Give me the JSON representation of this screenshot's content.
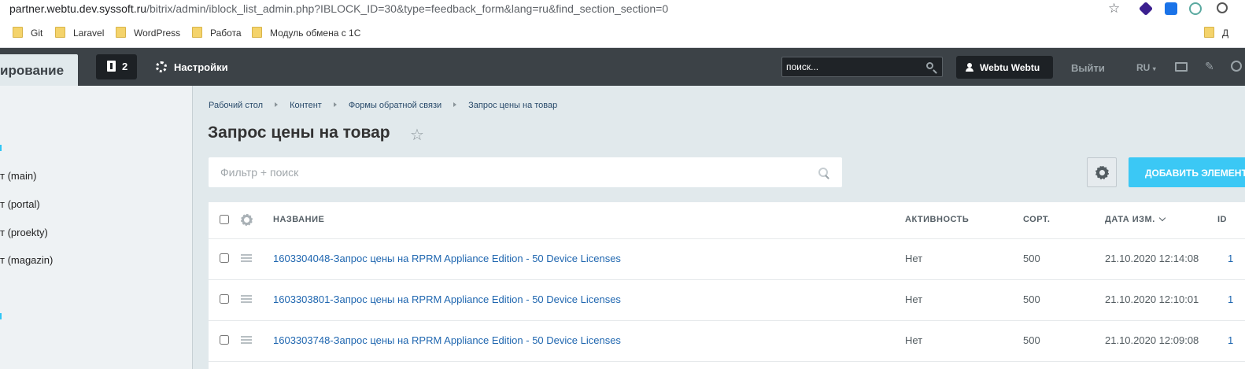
{
  "browser": {
    "url_host": "partner.webtu.dev.syssoft.ru",
    "url_path": "/bitrix/admin/iblock_list_admin.php?IBLOCK_ID=30&type=feedback_form&lang=ru&find_section_section=0",
    "bookmarks": [
      "Git",
      "Laravel",
      "WordPress",
      "Работа",
      "Модуль обмена с 1С"
    ],
    "bookmark_right": "Д"
  },
  "topbar": {
    "admin_tab": "ирование",
    "notifications_count": "2",
    "settings_label": "Настройки",
    "search_placeholder": "поиск...",
    "user_name": "Webtu Webtu",
    "logout_label": "Выйти",
    "lang_label": "RU"
  },
  "leftmenu": {
    "items": [
      "т (main)",
      "т (portal)",
      "т (proekty)",
      "т (magazin)"
    ]
  },
  "content": {
    "breadcrumbs": [
      "Рабочий стол",
      "Контент",
      "Формы обратной связи",
      "Запрос цены на товар"
    ],
    "title": "Запрос цены на товар",
    "filter_placeholder": "Фильтр + поиск",
    "add_button": "ДОБАВИТЬ ЭЛЕМЕНТ"
  },
  "grid": {
    "columns": [
      "НАЗВАНИЕ",
      "АКТИВНОСТЬ",
      "СОРТ.",
      "ДАТА ИЗМ.",
      "ID"
    ],
    "rows": [
      {
        "name": "1603304048-Запрос цены на RPRM Appliance Edition - 50 Device Licenses",
        "active": "Нет",
        "sort": "500",
        "date": "21.10.2020 12:14:08",
        "id": "1"
      },
      {
        "name": "1603303801-Запрос цены на RPRM Appliance Edition - 50 Device Licenses",
        "active": "Нет",
        "sort": "500",
        "date": "21.10.2020 12:10:01",
        "id": "1"
      },
      {
        "name": "1603303748-Запрос цены на RPRM Appliance Edition - 50 Device Licenses",
        "active": "Нет",
        "sort": "500",
        "date": "21.10.2020 12:09:08",
        "id": "1"
      }
    ]
  },
  "colors": {
    "topbar_bg": "#3c4247",
    "accent": "#3bc8f5",
    "link": "#2067b0",
    "page_bg": "#e1e9ec"
  }
}
